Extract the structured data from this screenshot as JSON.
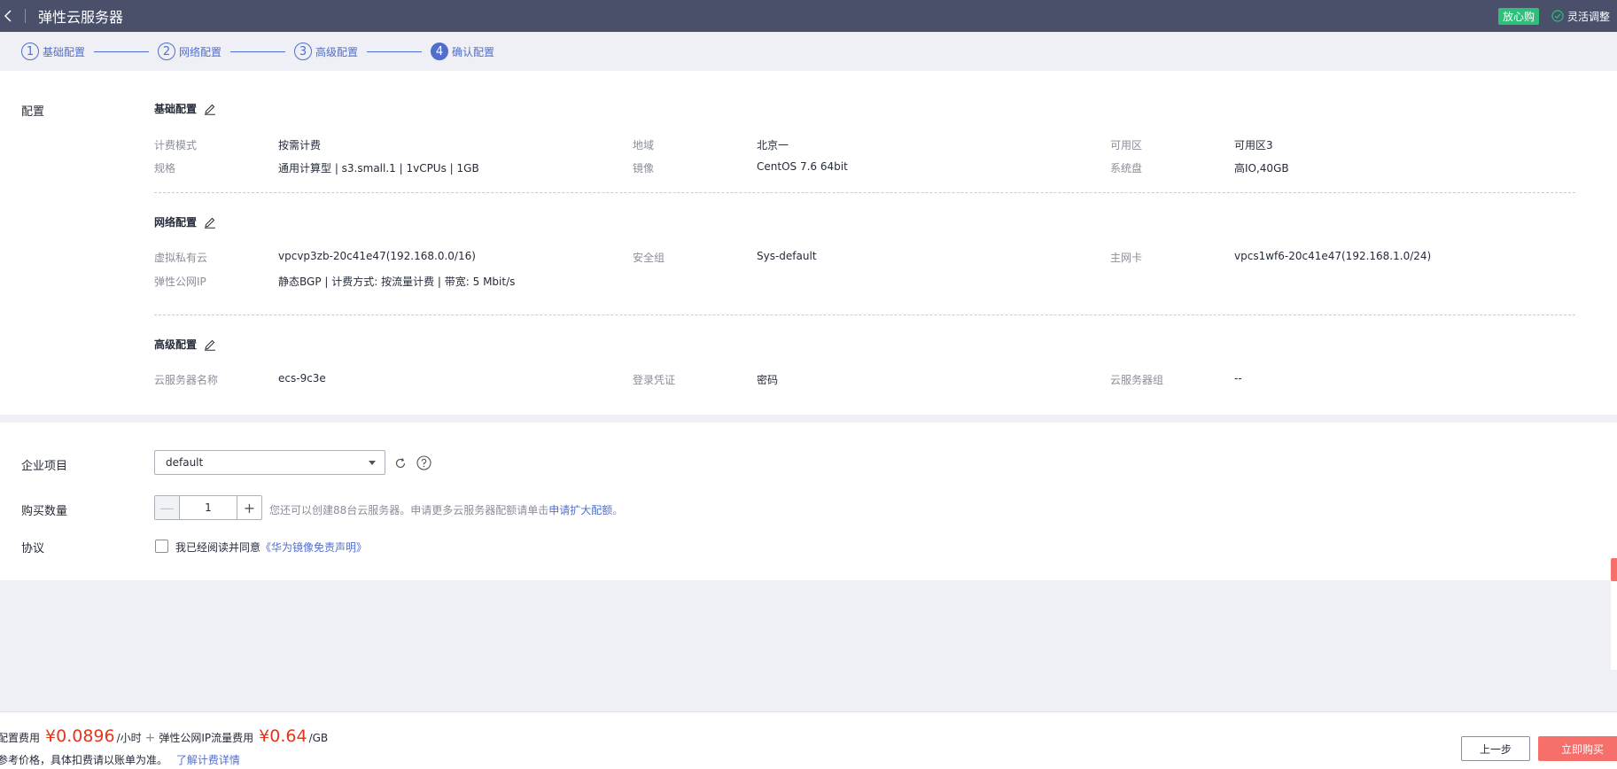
{
  "header": {
    "title": "弹性云服务器",
    "badge": "放心购",
    "flex_adjust": "灵活调整"
  },
  "steps": [
    {
      "num": "1",
      "label": "基础配置",
      "active": false
    },
    {
      "num": "2",
      "label": "网络配置",
      "active": false
    },
    {
      "num": "3",
      "label": "高级配置",
      "active": false
    },
    {
      "num": "4",
      "label": "确认配置",
      "active": true
    }
  ],
  "config": {
    "section_label": "配置",
    "basic": {
      "title": "基础配置",
      "billing_label": "计费模式",
      "billing_value": "按需计费",
      "region_label": "地域",
      "region_value": "北京一",
      "az_label": "可用区",
      "az_value": "可用区3",
      "flavor_label": "规格",
      "flavor_value": "通用计算型 | s3.small.1 | 1vCPUs | 1GB",
      "image_label": "镜像",
      "image_value": "CentOS 7.6 64bit",
      "disk_label": "系统盘",
      "disk_value": "高IO,40GB"
    },
    "network": {
      "title": "网络配置",
      "vpc_label": "虚拟私有云",
      "vpc_value": "vpcvp3zb-20c41e47(192.168.0.0/16)",
      "sg_label": "安全组",
      "sg_value": "Sys-default",
      "nic_label": "主网卡",
      "nic_value": "vpcs1wf6-20c41e47(192.168.1.0/24)",
      "eip_label": "弹性公网IP",
      "eip_value": "静态BGP | 计费方式: 按流量计费 | 带宽: 5 Mbit/s"
    },
    "advanced": {
      "title": "高级配置",
      "name_label": "云服务器名称",
      "name_value": "ecs-9c3e",
      "cred_label": "登录凭证",
      "cred_value": "密码",
      "group_label": "云服务器组",
      "group_value": "--"
    }
  },
  "purchase": {
    "project_label": "企业项目",
    "project_value": "default",
    "qty_label": "购买数量",
    "qty_value": "1",
    "qty_minus": "—",
    "qty_plus": "+",
    "hint_text": "您还可以创建88台云服务器。申请更多云服务器配额请单击",
    "hint_link": "申请扩大配额",
    "hint_end": "。",
    "agreement_label": "协议",
    "agree_text": "我已经阅读并同意",
    "agree_link": "《华为镜像免责声明》"
  },
  "footer": {
    "config_fee_label": "配置费用",
    "config_price": "¥0.0896",
    "config_unit": "/小时",
    "plus": "+",
    "eip_fee_label": "弹性公网IP流量费用",
    "eip_price": "¥0.64",
    "eip_unit": "/GB",
    "ref_text": "参考价格，具体扣费请以账单为准。",
    "ref_link": "了解计费详情",
    "prev_button": "上一步",
    "buy_button": "立即购买"
  },
  "colors": {
    "header_bg": "#4a4f6a",
    "accent": "#526ecc",
    "price_red": "#e4361a",
    "buy_button": "#f66f6a",
    "badge_green": "#2fbf7a"
  }
}
